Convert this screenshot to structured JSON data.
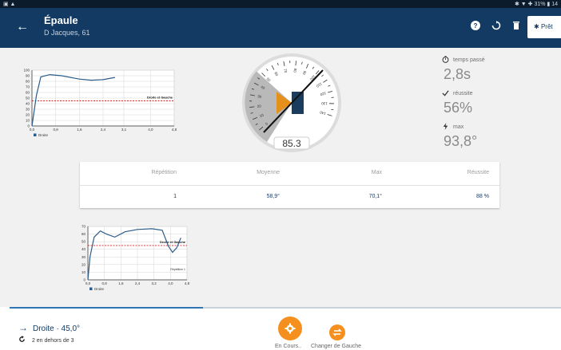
{
  "statusbar": {
    "left": "▣ ▲",
    "right": "✱ ▼ ✚ 31% ▮ 14"
  },
  "appbar": {
    "back": "←",
    "title": "Épaule",
    "subtitle": "D Jacques, 61",
    "pret": "Prêt",
    "icons": [
      "help-icon",
      "reset-icon",
      "delete-icon",
      "bluetooth-icon"
    ]
  },
  "chart1_data": {
    "type": "line",
    "yticks": [
      "100",
      "90",
      "80",
      "70",
      "60",
      "50",
      "40",
      "30",
      "20",
      "10",
      "0"
    ],
    "xticks": [
      "0,0",
      "0,8",
      "1,6",
      "2,4",
      "3,1",
      "4,0",
      "4,8"
    ],
    "threshold_label": "Droite et Gauche",
    "threshold": 45,
    "legend": "Droite",
    "series_color": "#2b5c8a",
    "threshold_color": "#e02020",
    "points": [
      [
        0.0,
        0
      ],
      [
        0.15,
        55
      ],
      [
        0.3,
        88
      ],
      [
        0.6,
        92
      ],
      [
        1.0,
        90
      ],
      [
        1.6,
        84
      ],
      [
        2.0,
        82
      ],
      [
        2.4,
        83
      ],
      [
        2.8,
        87
      ]
    ]
  },
  "chart2_data": {
    "type": "line",
    "yticks": [
      "70",
      "60",
      "50",
      "40",
      "30",
      "20",
      "10",
      "0"
    ],
    "xticks": [
      "0,0",
      "0,8",
      "1,6",
      "2,4",
      "3,2",
      "4,0",
      "4,8"
    ],
    "threshold_label": "Droite et Gauche",
    "repetition_label": "Répétition 1",
    "threshold": 45,
    "legend": "Droite",
    "series_color": "#2b5c8a",
    "threshold_color": "#e02020",
    "points": [
      [
        0.0,
        0
      ],
      [
        0.1,
        30
      ],
      [
        0.3,
        56
      ],
      [
        0.6,
        64
      ],
      [
        0.9,
        60
      ],
      [
        1.3,
        56
      ],
      [
        1.8,
        63
      ],
      [
        2.4,
        66
      ],
      [
        3.1,
        67
      ],
      [
        3.6,
        65
      ],
      [
        3.9,
        44
      ],
      [
        4.1,
        36
      ],
      [
        4.3,
        42
      ],
      [
        4.5,
        55
      ]
    ]
  },
  "gauge": {
    "value": "85.3",
    "ticks": [
      "0",
      "10",
      "20",
      "30",
      "40",
      "50",
      "60",
      "70",
      "80",
      "90",
      "100",
      "110",
      "120",
      "130",
      "140"
    ]
  },
  "stats": [
    {
      "icon": "stopwatch-icon",
      "label": "temps passé",
      "value": "2,8s"
    },
    {
      "icon": "check-icon",
      "label": "réussite",
      "value": "56%"
    },
    {
      "icon": "lightning-icon",
      "label": "max",
      "value": "93,8°"
    }
  ],
  "table": {
    "headers": [
      "Répétition",
      "Moyenne",
      "Max",
      "Réussite"
    ],
    "row": [
      "1",
      "58,9°",
      "70,1°",
      "88 %"
    ]
  },
  "bottom": {
    "side_label": "Droite · 45,0°",
    "counter": "2 en dehors de 3",
    "fab1_label": "En Cours..",
    "fab2_label": "Changer de Gauche",
    "progress": 0.35
  }
}
